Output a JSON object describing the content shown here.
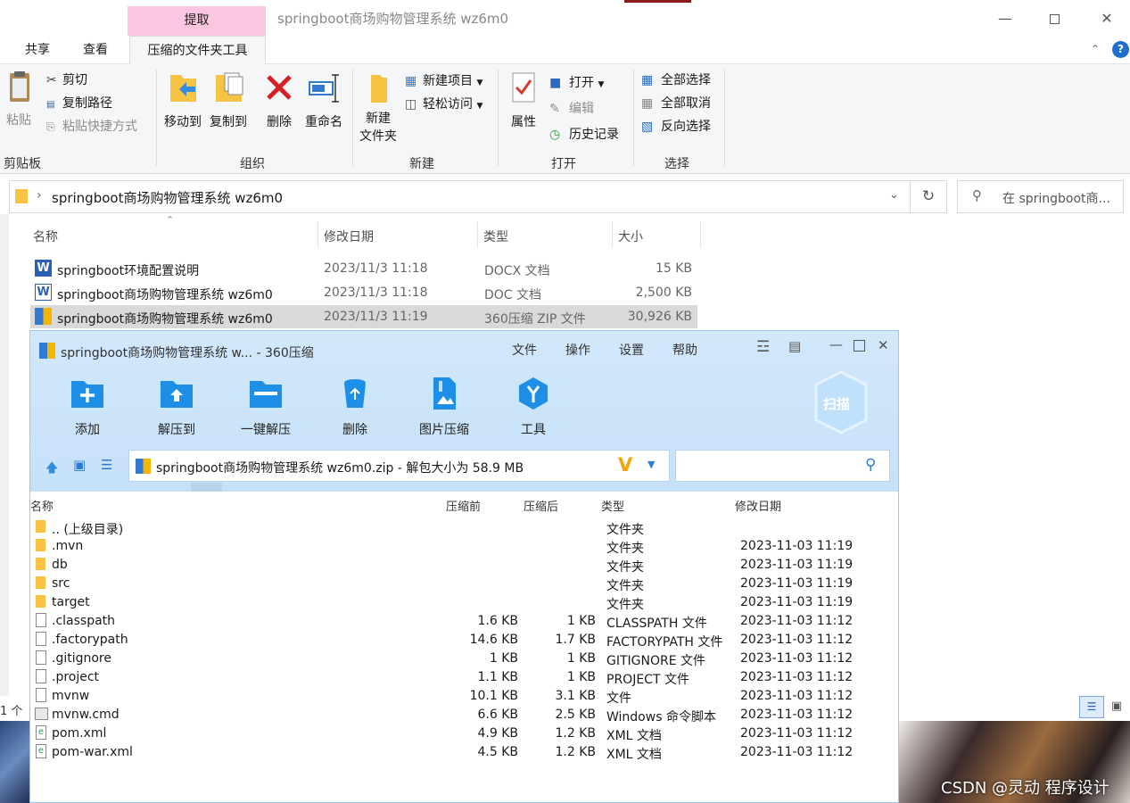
{
  "explorer": {
    "context_tab": "提取",
    "title": "springboot商场购物管理系统  wz6m0",
    "tabs": [
      "共享",
      "查看"
    ],
    "active_tab": "压缩的文件夹工具",
    "help": "?",
    "ribbon": {
      "paste": "粘贴",
      "cut": "剪切",
      "copy_path": "复制路径",
      "paste_shortcut": "粘贴快捷方式",
      "clipboard": "剪贴板",
      "move_to": "移动到",
      "copy_to": "复制到",
      "delete": "删除",
      "rename": "重命名",
      "organize": "组织",
      "new_folder_1": "新建",
      "new_folder_2": "文件夹",
      "new_item": "新建项目",
      "easy_access": "轻松访问",
      "new": "新建",
      "properties": "属性",
      "open_btn": "打开",
      "edit": "编辑",
      "history": "历史记录",
      "open": "打开",
      "select_all": "全部选择",
      "select_none": "全部取消",
      "invert": "反向选择",
      "select": "选择"
    },
    "address": "springboot商场购物管理系统  wz6m0",
    "search_placeholder": "在 springboot商...",
    "columns": [
      "名称",
      "修改日期",
      "类型",
      "大小"
    ],
    "files": [
      {
        "name": "springboot环境配置说明",
        "date": "2023/11/3 11:18",
        "type": "DOCX 文档",
        "size": "15 KB",
        "icon": "word-docx-icon"
      },
      {
        "name": "springboot商场购物管理系统  wz6m0",
        "date": "2023/11/3 11:18",
        "type": "DOC 文档",
        "size": "2,500 KB",
        "icon": "word-doc-icon"
      },
      {
        "name": "springboot商场购物管理系统  wz6m0",
        "date": "2023/11/3 11:19",
        "type": "360压缩 ZIP 文件",
        "size": "30,926 KB",
        "icon": "zip-archive-icon"
      }
    ],
    "status_left": "1 个"
  },
  "zip": {
    "title": "springboot商场购物管理系统  w... - 360压缩",
    "menu": [
      "文件",
      "操作",
      "设置",
      "帮助"
    ],
    "tools": [
      "添加",
      "解压到",
      "一键解压",
      "删除",
      "图片压缩",
      "工具"
    ],
    "scan": "扫描",
    "address": "springboot商场购物管理系统  wz6m0.zip - 解包大小为 58.9 MB",
    "columns": [
      "名称",
      "压缩前",
      "压缩后",
      "类型",
      "修改日期"
    ],
    "rows": [
      {
        "name": ".. (上级目录)",
        "before": "",
        "after": "",
        "type": "文件夹",
        "date": "",
        "kind": "folder"
      },
      {
        "name": ".mvn",
        "before": "",
        "after": "",
        "type": "文件夹",
        "date": "2023-11-03 11:19",
        "kind": "folder"
      },
      {
        "name": "db",
        "before": "",
        "after": "",
        "type": "文件夹",
        "date": "2023-11-03 11:19",
        "kind": "folder"
      },
      {
        "name": "src",
        "before": "",
        "after": "",
        "type": "文件夹",
        "date": "2023-11-03 11:19",
        "kind": "folder"
      },
      {
        "name": "target",
        "before": "",
        "after": "",
        "type": "文件夹",
        "date": "2023-11-03 11:19",
        "kind": "folder"
      },
      {
        "name": ".classpath",
        "before": "1.6 KB",
        "after": "1 KB",
        "type": "CLASSPATH 文件",
        "date": "2023-11-03 11:12",
        "kind": "file"
      },
      {
        "name": ".factorypath",
        "before": "14.6 KB",
        "after": "1.7 KB",
        "type": "FACTORYPATH 文件",
        "date": "2023-11-03 11:12",
        "kind": "file"
      },
      {
        "name": ".gitignore",
        "before": "1 KB",
        "after": "1 KB",
        "type": "GITIGNORE 文件",
        "date": "2023-11-03 11:12",
        "kind": "file"
      },
      {
        "name": ".project",
        "before": "1.1 KB",
        "after": "1 KB",
        "type": "PROJECT 文件",
        "date": "2023-11-03 11:12",
        "kind": "file"
      },
      {
        "name": "mvnw",
        "before": "10.1 KB",
        "after": "3.1 KB",
        "type": "文件",
        "date": "2023-11-03 11:12",
        "kind": "file"
      },
      {
        "name": "mvnw.cmd",
        "before": "6.6 KB",
        "after": "2.5 KB",
        "type": "Windows 命令脚本",
        "date": "2023-11-03 11:12",
        "kind": "cmd"
      },
      {
        "name": "pom.xml",
        "before": "4.9 KB",
        "after": "1.2 KB",
        "type": "XML 文档",
        "date": "2023-11-03 11:12",
        "kind": "xml"
      },
      {
        "name": "pom-war.xml",
        "before": "4.5 KB",
        "after": "1.2 KB",
        "type": "XML 文档",
        "date": "2023-11-03 11:12",
        "kind": "xml"
      }
    ]
  },
  "watermark": "CSDN @灵动 程序设计"
}
